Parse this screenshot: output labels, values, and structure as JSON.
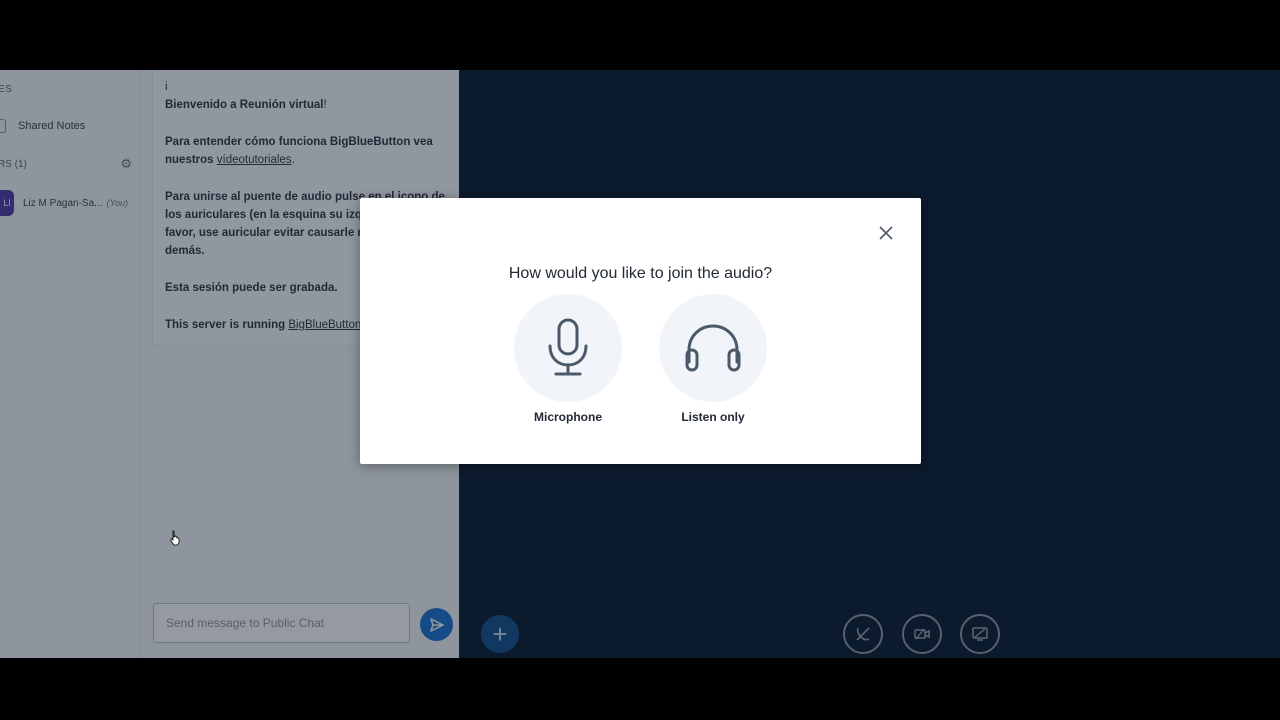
{
  "userlist": {
    "section_title": "ES",
    "shared_notes_label": "Shared Notes",
    "users_title": "RS (1)",
    "user": {
      "avatar_text": "LI",
      "name": "Liz M Pagan-Sa...",
      "you_label": "(You)"
    }
  },
  "chat": {
    "line1": "i",
    "welcome_prefix": "Bienvenido a ",
    "welcome_name": "Reunión virtual",
    "welcome_suffix": "!",
    "para1_text": "Para entender cómo funciona BigBlueButton vea nuestros ",
    "para1_link": "vídeotutoriales",
    "para1_end": ".",
    "para2": "Para unirse al puente de audio pulse en el icono de los auriculares (en la esquina su izquierda). Por favor, use auricular evitar causarle ruido a los demás.",
    "para3": "Esta sesión puede ser grabada.",
    "para4_text": "This server is running ",
    "para4_link": "BigBlueButton",
    "input_placeholder": "Send message to Public Chat"
  },
  "modal": {
    "title": "How would you like to join the audio?",
    "option_microphone": "Microphone",
    "option_listen": "Listen only"
  },
  "colors": {
    "main_bg": "#06172e",
    "accent": "#1b6fd1",
    "panel_bg": "#f3f6f9"
  }
}
